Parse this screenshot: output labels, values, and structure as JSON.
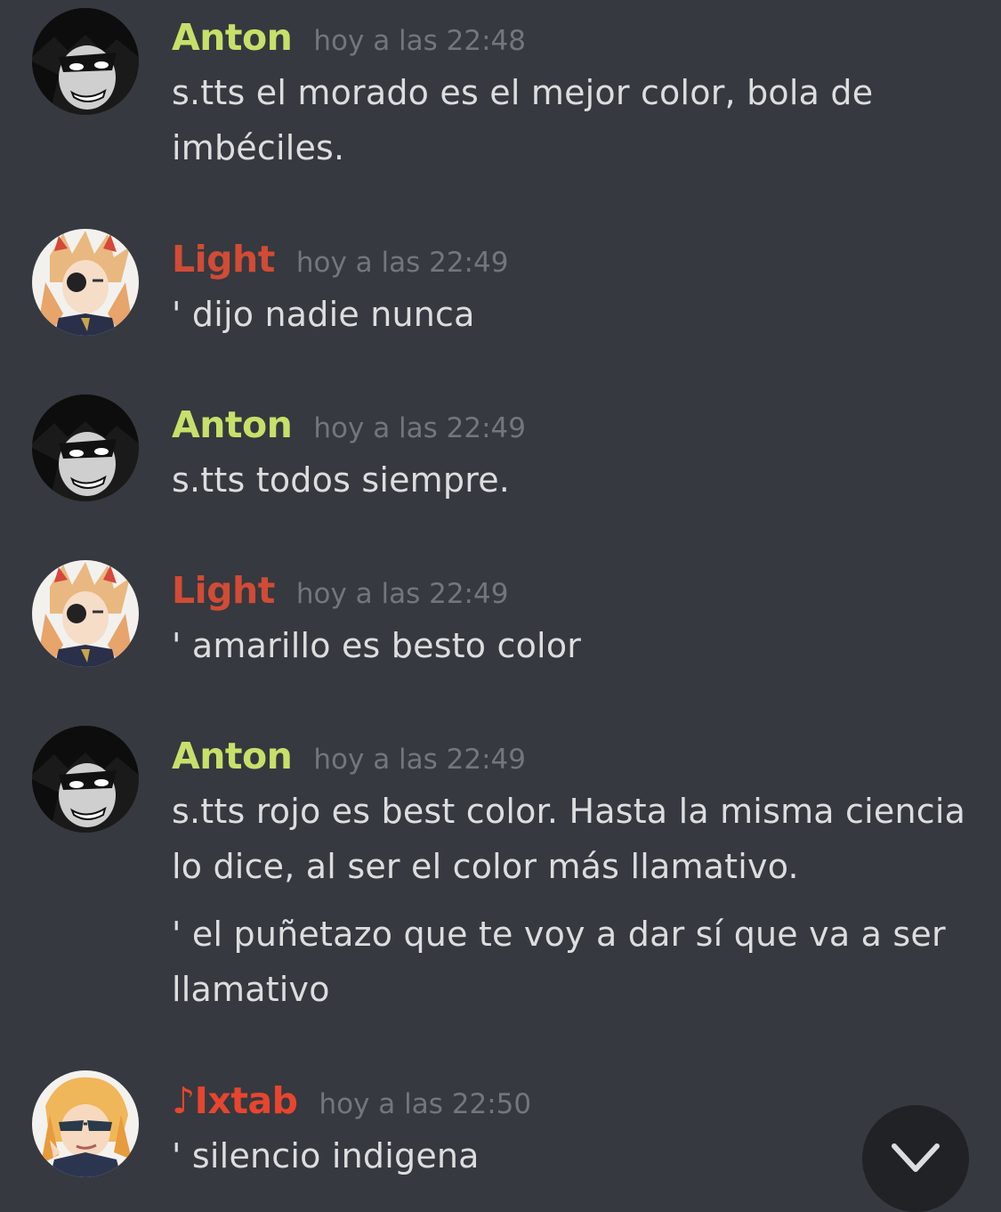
{
  "colors": {
    "background": "#36393f",
    "anton_name": "#c6e06a",
    "light_name": "#d14b35",
    "ixtab_name": "#e8452e",
    "timestamp": "#72767d",
    "text": "#dcddde"
  },
  "messages": [
    {
      "author": "Anton",
      "timestamp": "hoy a las 22:48",
      "lines": [
        "s.tts el morado es el mejor color, bola de imbéciles."
      ]
    },
    {
      "author": "Light",
      "timestamp": "hoy a las 22:49",
      "lines": [
        "' dijo nadie nunca"
      ]
    },
    {
      "author": "Anton",
      "timestamp": "hoy a las 22:49",
      "lines": [
        "s.tts todos siempre."
      ]
    },
    {
      "author": "Light",
      "timestamp": "hoy a las 22:49",
      "lines": [
        "' amarillo es besto color"
      ]
    },
    {
      "author": "Anton",
      "timestamp": "hoy a las 22:49",
      "lines": [
        "s.tts rojo es best color. Hasta la misma ciencia lo dice, al ser el color más llamativo.",
        "' el puñetazo que te voy a dar sí que va a ser llamativo"
      ]
    },
    {
      "author": "♪Ixtab",
      "timestamp": "hoy a las 22:50",
      "lines": [
        "' silencio indigena"
      ]
    }
  ],
  "jump_to_present": {
    "icon": "chevron-down-icon"
  }
}
